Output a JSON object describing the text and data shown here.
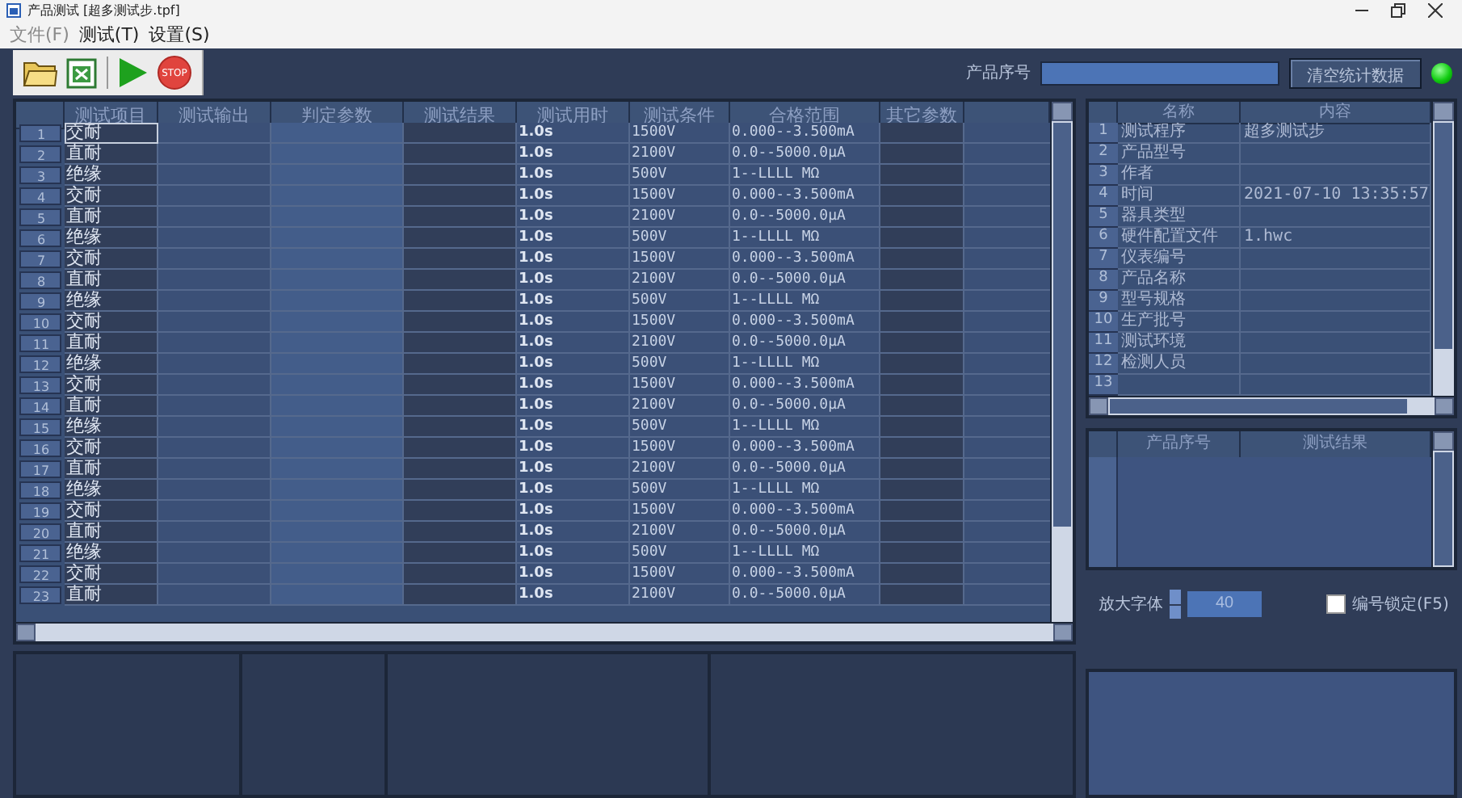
{
  "window": {
    "title": "产品测试 [超多测试步.tpf]"
  },
  "menu": [
    {
      "label": "文件(F)",
      "disabled": true
    },
    {
      "label": "测试(T)",
      "disabled": false
    },
    {
      "label": "设置(S)",
      "disabled": false
    }
  ],
  "toolbar": {
    "stop_label": "STOP",
    "serial_label": "产品序号",
    "clear_button": "清空统计数据",
    "status_on": true
  },
  "steps_table": {
    "columns": [
      "测试项目",
      "测试输出",
      "判定参数",
      "测试结果",
      "测试用时",
      "测试条件",
      "合格范围",
      "其它参数"
    ],
    "rows": [
      {
        "number": "1",
        "item": "交耐",
        "time": "1.0s",
        "condition": "1500V",
        "range": "0.000--3.500mA",
        "selected": true
      },
      {
        "number": "2",
        "item": "直耐",
        "time": "1.0s",
        "condition": "2100V",
        "range": "0.0--5000.0μA",
        "selected": false
      },
      {
        "number": "3",
        "item": "绝缘",
        "time": "1.0s",
        "condition": "500V",
        "range": "1--LLLL MΩ",
        "selected": false
      },
      {
        "number": "4",
        "item": "交耐",
        "time": "1.0s",
        "condition": "1500V",
        "range": "0.000--3.500mA",
        "selected": false
      },
      {
        "number": "5",
        "item": "直耐",
        "time": "1.0s",
        "condition": "2100V",
        "range": "0.0--5000.0μA",
        "selected": false
      },
      {
        "number": "6",
        "item": "绝缘",
        "time": "1.0s",
        "condition": "500V",
        "range": "1--LLLL MΩ",
        "selected": false
      },
      {
        "number": "7",
        "item": "交耐",
        "time": "1.0s",
        "condition": "1500V",
        "range": "0.000--3.500mA",
        "selected": false
      },
      {
        "number": "8",
        "item": "直耐",
        "time": "1.0s",
        "condition": "2100V",
        "range": "0.0--5000.0μA",
        "selected": false
      },
      {
        "number": "9",
        "item": "绝缘",
        "time": "1.0s",
        "condition": "500V",
        "range": "1--LLLL MΩ",
        "selected": false
      },
      {
        "number": "10",
        "item": "交耐",
        "time": "1.0s",
        "condition": "1500V",
        "range": "0.000--3.500mA",
        "selected": false
      },
      {
        "number": "11",
        "item": "直耐",
        "time": "1.0s",
        "condition": "2100V",
        "range": "0.0--5000.0μA",
        "selected": false
      },
      {
        "number": "12",
        "item": "绝缘",
        "time": "1.0s",
        "condition": "500V",
        "range": "1--LLLL MΩ",
        "selected": false
      },
      {
        "number": "13",
        "item": "交耐",
        "time": "1.0s",
        "condition": "1500V",
        "range": "0.000--3.500mA",
        "selected": false
      },
      {
        "number": "14",
        "item": "直耐",
        "time": "1.0s",
        "condition": "2100V",
        "range": "0.0--5000.0μA",
        "selected": false
      },
      {
        "number": "15",
        "item": "绝缘",
        "time": "1.0s",
        "condition": "500V",
        "range": "1--LLLL MΩ",
        "selected": false
      },
      {
        "number": "16",
        "item": "交耐",
        "time": "1.0s",
        "condition": "1500V",
        "range": "0.000--3.500mA",
        "selected": false
      },
      {
        "number": "17",
        "item": "直耐",
        "time": "1.0s",
        "condition": "2100V",
        "range": "0.0--5000.0μA",
        "selected": false
      },
      {
        "number": "18",
        "item": "绝缘",
        "time": "1.0s",
        "condition": "500V",
        "range": "1--LLLL MΩ",
        "selected": false
      },
      {
        "number": "19",
        "item": "交耐",
        "time": "1.0s",
        "condition": "1500V",
        "range": "0.000--3.500mA",
        "selected": false
      },
      {
        "number": "20",
        "item": "直耐",
        "time": "1.0s",
        "condition": "2100V",
        "range": "0.0--5000.0μA",
        "selected": false
      },
      {
        "number": "21",
        "item": "绝缘",
        "time": "1.0s",
        "condition": "500V",
        "range": "1--LLLL MΩ",
        "selected": false
      },
      {
        "number": "22",
        "item": "交耐",
        "time": "1.0s",
        "condition": "1500V",
        "range": "0.000--3.500mA",
        "selected": false
      },
      {
        "number": "23",
        "item": "直耐",
        "time": "1.0s",
        "condition": "2100V",
        "range": "0.0--5000.0μA",
        "selected": false
      }
    ]
  },
  "info_table": {
    "columns": [
      "名称",
      "内容"
    ],
    "rows": [
      {
        "number": "1",
        "name": "测试程序",
        "content": "超多测试步"
      },
      {
        "number": "2",
        "name": "产品型号"
      },
      {
        "number": "3",
        "name": "作者"
      },
      {
        "number": "4",
        "name": "时间",
        "content": "2021-07-10 13:35:57"
      },
      {
        "number": "5",
        "name": "器具类型"
      },
      {
        "number": "6",
        "name": "硬件配置文件",
        "content": "1.hwc"
      },
      {
        "number": "7",
        "name": "仪表编号"
      },
      {
        "number": "8",
        "name": "产品名称"
      },
      {
        "number": "9",
        "name": "型号规格"
      },
      {
        "number": "10",
        "name": "生产批号"
      },
      {
        "number": "11",
        "name": "测试环境"
      },
      {
        "number": "12",
        "name": "检测人员"
      },
      {
        "number": "13"
      }
    ]
  },
  "results_table": {
    "columns": [
      "产品序号",
      "测试结果"
    ]
  },
  "font_size": {
    "label": "放大字体",
    "value": "40"
  },
  "lock_checkbox": {
    "label": "编号锁定(F5)",
    "checked": false
  }
}
